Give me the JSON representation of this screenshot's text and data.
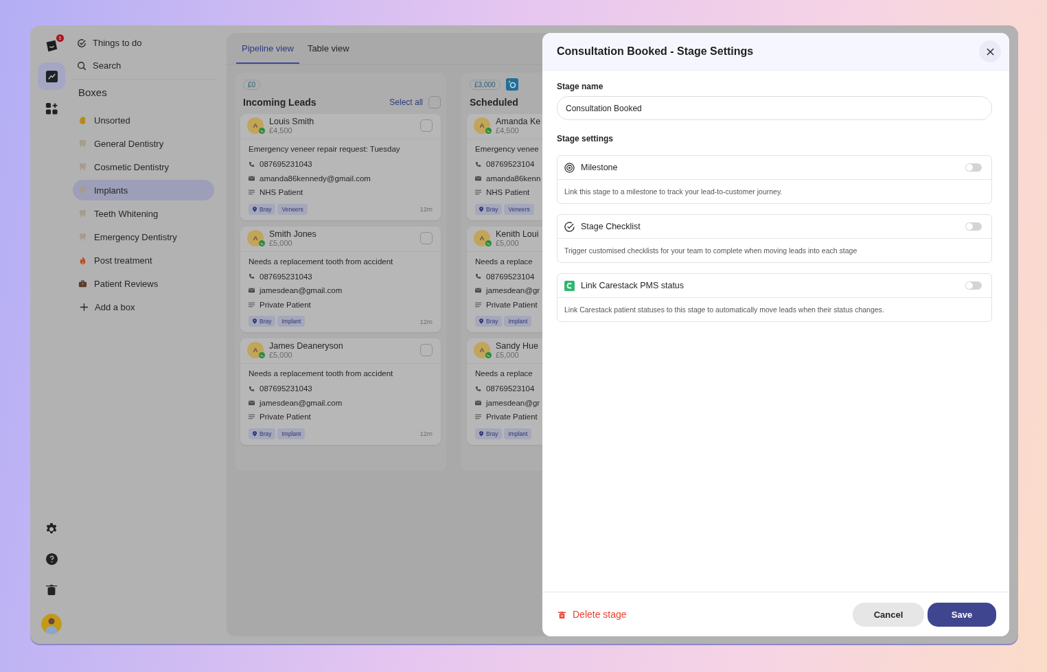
{
  "rail": {
    "badge": "5",
    "items": [
      {
        "kind": "chart",
        "selected": true
      },
      {
        "kind": "apps",
        "selected": false
      }
    ]
  },
  "nav": {
    "top": [
      {
        "kind": "todo",
        "label": "Things to do"
      },
      {
        "kind": "search",
        "label": "Search"
      }
    ],
    "section_title": "Boxes",
    "boxes": [
      {
        "kind": "hand",
        "label": "Unsorted",
        "selected": false
      },
      {
        "kind": "tooth",
        "label": "General Dentistry",
        "selected": false
      },
      {
        "kind": "tooth",
        "label": "Cosmetic Dentistry",
        "selected": false
      },
      {
        "kind": "tooth",
        "label": "Implants",
        "selected": true
      },
      {
        "kind": "tooth",
        "label": "Teeth Whitening",
        "selected": false
      },
      {
        "kind": "tooth",
        "label": "Emergency Dentistry",
        "selected": false
      },
      {
        "kind": "fire",
        "label": "Post treatment",
        "selected": false
      },
      {
        "kind": "briefcase",
        "label": "Patient Reviews",
        "selected": false
      }
    ],
    "add_label": "Add a box"
  },
  "views": [
    {
      "label": "Pipeline view",
      "selected": true
    },
    {
      "label": "Table view",
      "selected": false
    }
  ],
  "columns": [
    {
      "amount": "£0",
      "title": "Incoming Leads",
      "select_all": "Select all",
      "select_all_checked": false,
      "integration": false,
      "cards": [
        {
          "initial": "A",
          "name": "Louis Smith",
          "value": "£4,500",
          "checked": false,
          "note": "Emergency veneer repair request: Tuesday",
          "phone": "087695231043",
          "email": "amanda86kennedy@gmail.com",
          "patient_type": "NHS Patient",
          "tags": [
            {
              "kind": "location",
              "label": "Bray"
            },
            {
              "kind": "plain",
              "label": "Veneers"
            }
          ],
          "age": "12m"
        },
        {
          "initial": "A",
          "name": "Smith Jones",
          "value": "£5,000",
          "checked": false,
          "note": "Needs a replacement tooth from accident",
          "phone": "087695231043",
          "email": "jamesdean@gmail.com",
          "patient_type": "Private Patient",
          "tags": [
            {
              "kind": "location",
              "label": "Bray"
            },
            {
              "kind": "plain",
              "label": "Implant"
            }
          ],
          "age": "12m"
        },
        {
          "initial": "A",
          "name": "James Deaneryson",
          "value": "£5,000",
          "checked": false,
          "note": "Needs a replacement tooth from accident",
          "phone": "087695231043",
          "email": "jamesdean@gmail.com",
          "patient_type": "Private Patient",
          "tags": [
            {
              "kind": "location",
              "label": "Bray"
            },
            {
              "kind": "plain",
              "label": "Implant"
            }
          ],
          "age": "12m"
        }
      ]
    },
    {
      "amount": "£3,000",
      "title": "Scheduled",
      "integration": true,
      "cards": [
        {
          "initial": "A",
          "name": "Amanda Ke",
          "value": "£4,500",
          "note": "Emergency venee",
          "phone": "08769523104",
          "email": "amanda86kenn",
          "patient_type": "NHS Patient",
          "tags": [
            {
              "kind": "location",
              "label": "Bray"
            },
            {
              "kind": "plain",
              "label": "Veneers"
            }
          ]
        },
        {
          "initial": "A",
          "name": "Kenith Loui",
          "value": "£5,000",
          "note": "Needs a replace",
          "phone": "08769523104",
          "email": "jamesdean@gr",
          "patient_type": "Private Patient",
          "tags": [
            {
              "kind": "location",
              "label": "Bray"
            },
            {
              "kind": "plain",
              "label": "Implant"
            }
          ]
        },
        {
          "initial": "A",
          "name": "Sandy Hue",
          "value": "£5,000",
          "note": "Needs a replace",
          "phone": "08769523104",
          "email": "jamesdean@gr",
          "patient_type": "Private Patient",
          "tags": [
            {
              "kind": "location",
              "label": "Bray"
            },
            {
              "kind": "plain",
              "label": "Implant"
            }
          ]
        }
      ]
    }
  ],
  "modal": {
    "title": "Consultation Booked - Stage Settings",
    "stage_name_label": "Stage name",
    "stage_name_value": "Consultation Booked",
    "settings_label": "Stage settings",
    "settings": [
      {
        "kind": "milestone",
        "label": "Milestone",
        "on": false,
        "description": "Link this stage to a milestone to track your lead-to-customer journey."
      },
      {
        "kind": "checklist",
        "label": "Stage Checklist",
        "on": false,
        "description": "Trigger customised checklists for your team to complete when moving leads into each stage"
      },
      {
        "kind": "carestack",
        "label": "Link Carestack PMS status",
        "on": false,
        "description": "Link Carestack patient statuses to this stage to automatically move leads when their status changes."
      }
    ],
    "delete_label": "Delete stage",
    "cancel_label": "Cancel",
    "save_label": "Save"
  }
}
